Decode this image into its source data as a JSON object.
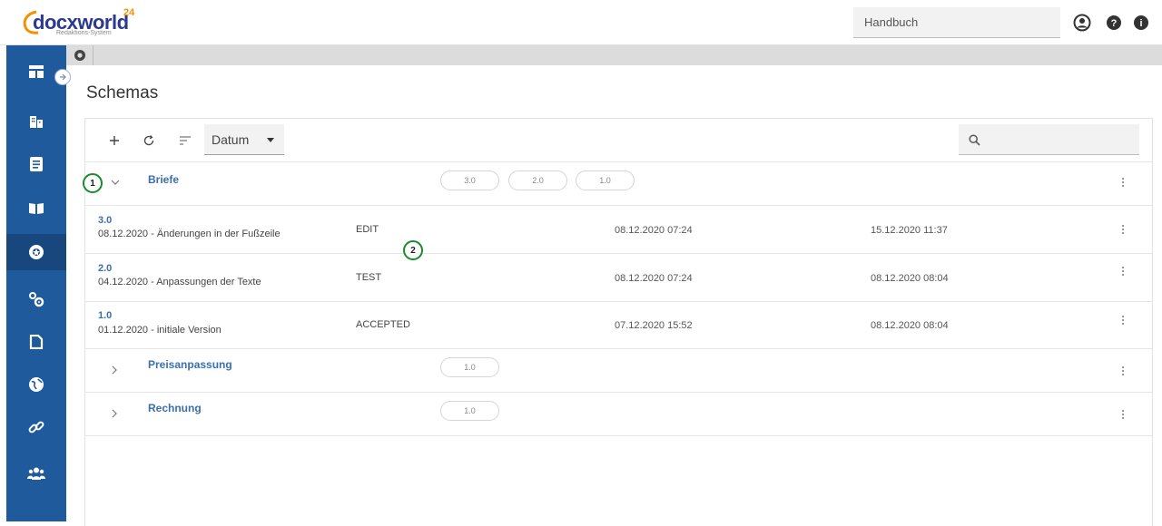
{
  "app": {
    "logo_text": "docxworld",
    "logo_sup": "24",
    "logo_subtitle": "Redaktions-System"
  },
  "topbar": {
    "search_value": "Handbuch",
    "icons": [
      "user-icon",
      "help-icon",
      "info-icon"
    ]
  },
  "sidebar": {
    "items": [
      {
        "icon": "dashboard-icon"
      },
      {
        "icon": "buildings-icon"
      },
      {
        "icon": "document-icon"
      },
      {
        "icon": "book-icon"
      },
      {
        "icon": "schema-icon",
        "active": true
      },
      {
        "icon": "gears-icon"
      },
      {
        "icon": "page-icon"
      },
      {
        "icon": "globe-icon"
      },
      {
        "icon": "link-icon"
      },
      {
        "icon": "users-icon"
      }
    ],
    "accent": "#1f5a9c",
    "active_color": "#17477d"
  },
  "page": {
    "title": "Schemas"
  },
  "toolbar": {
    "sort_value": "Datum"
  },
  "groups": [
    {
      "name": "Briefe",
      "expanded": true,
      "versions": [
        "3.0",
        "2.0",
        "1.0"
      ],
      "rows": [
        {
          "version": "3.0",
          "description": "08.12.2020 - Änderungen in der Fußzeile",
          "status": "EDIT",
          "created": "08.12.2020 07:24",
          "modified": "15.12.2020 11:37"
        },
        {
          "version": "2.0",
          "description": "04.12.2020 - Anpassungen der Texte",
          "status": "TEST",
          "created": "08.12.2020 07:24",
          "modified": "08.12.2020 08:04"
        },
        {
          "version": "1.0",
          "description": "01.12.2020 - initiale Version",
          "status": "ACCEPTED",
          "created": "07.12.2020 15:52",
          "modified": "08.12.2020 08:04"
        }
      ]
    },
    {
      "name": "Preisanpassung",
      "expanded": false,
      "versions": [
        "1.0"
      ]
    },
    {
      "name": "Rechnung",
      "expanded": false,
      "versions": [
        "1.0"
      ]
    }
  ],
  "markers": [
    "1",
    "2"
  ],
  "colors": {
    "link": "#3b6fb0",
    "marker_border": "#1a8a2a"
  }
}
